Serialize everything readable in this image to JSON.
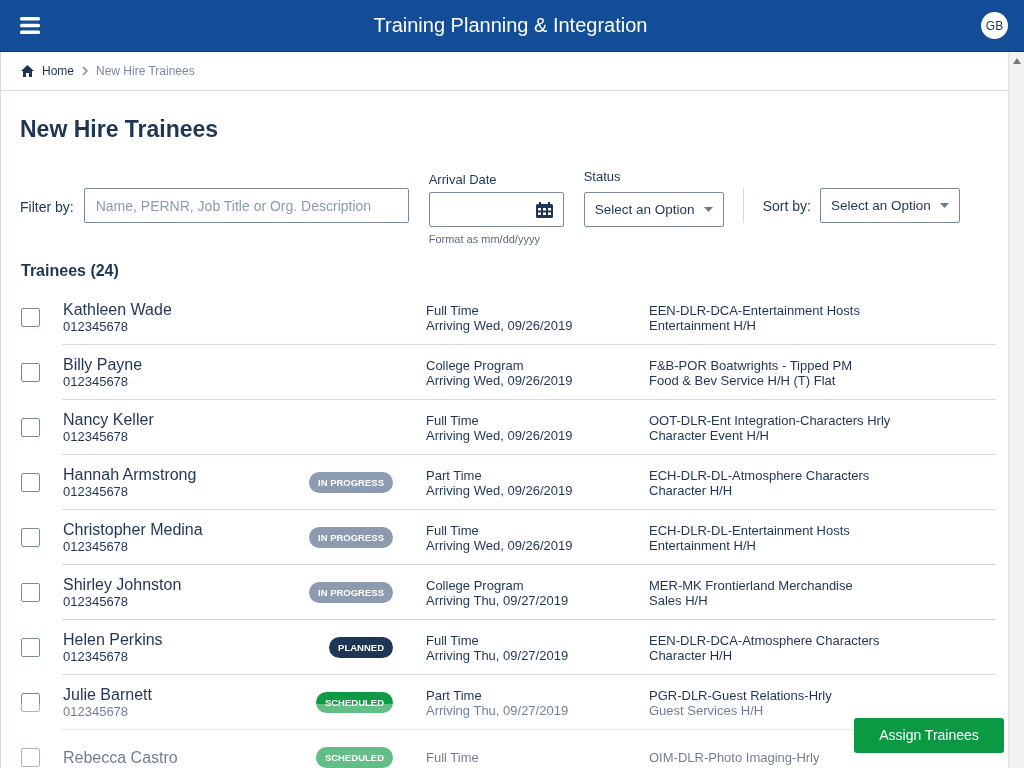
{
  "header": {
    "title": "Training Planning & Integration",
    "avatar": "GB"
  },
  "breadcrumb": [
    {
      "label": "Home",
      "current": false
    },
    {
      "label": "New Hire Trainees",
      "current": true
    }
  ],
  "page_title": "New Hire Trainees",
  "filters": {
    "filter_label": "Filter by:",
    "search_placeholder": "Name, PERNR, Job Title or Org. Description",
    "arrival_label": "Arrival Date",
    "arrival_hint": "Format as mm/dd/yyyy",
    "status_label": "Status",
    "status_value": "Select an Option",
    "sort_label": "Sort by:",
    "sort_value": "Select an Option"
  },
  "list_title": "Trainees (24)",
  "trainees": [
    {
      "name": "Kathleen Wade",
      "id": "012345678",
      "type": "Full Time",
      "arrival": "Arriving Wed, 09/26/2019",
      "org": "EEN-DLR-DCA-Entertainment Hosts",
      "role": "Entertainment H/H",
      "checked": false
    },
    {
      "name": "Billy Payne",
      "id": "012345678",
      "type": "College Program",
      "arrival": "Arriving Wed, 09/26/2019",
      "org": "F&B-POR Boatwrights - Tipped PM",
      "role": "Food & Bev Service H/H (T) Flat",
      "checked": false
    },
    {
      "name": "Nancy Keller",
      "id": "012345678",
      "type": "Full Time",
      "arrival": "Arriving Wed, 09/26/2019",
      "org": "OOT-DLR-Ent Integration-Characters Hrly",
      "role": "Character Event H/H",
      "checked": false
    },
    {
      "name": "Hannah Armstrong",
      "id": "012345678",
      "status": {
        "kind": "in_progress",
        "label": "IN PROGRESS"
      },
      "type": "Part Time",
      "arrival": "Arriving Wed, 09/26/2019",
      "org": "ECH-DLR-DL-Atmosphere Characters",
      "role": "Character H/H",
      "checked": false
    },
    {
      "name": "Christopher Medina",
      "id": "012345678",
      "status": {
        "kind": "in_progress",
        "label": "IN PROGRESS"
      },
      "type": "Full Time",
      "arrival": "Arriving Wed, 09/26/2019",
      "org": "ECH-DLR-DL-Entertainment Hosts",
      "role": "Entertainment H/H",
      "checked": false
    },
    {
      "name": "Shirley Johnston",
      "id": "012345678",
      "status": {
        "kind": "in_progress",
        "label": "IN PROGRESS"
      },
      "type": "College Program",
      "arrival": "Arriving Thu, 09/27/2019",
      "org": "MER-MK Frontierland Merchandise",
      "role": "Sales H/H",
      "checked": false
    },
    {
      "name": "Helen Perkins",
      "id": "012345678",
      "status": {
        "kind": "planned",
        "label": "PLANNED"
      },
      "type": "Full Time",
      "arrival": "Arriving Thu, 09/27/2019",
      "org": "EEN-DLR-DCA-Atmosphere Characters",
      "role": "Character H/H",
      "checked": false
    },
    {
      "name": "Julie Barnett",
      "id": "012345678",
      "status": {
        "kind": "scheduled",
        "label": "SCHEDULED"
      },
      "type": "Part Time",
      "arrival": "Arriving Thu, 09/27/2019",
      "org": "PGR-DLR-Guest Relations-Hrly",
      "role": "Guest Services H/H",
      "checked": false
    },
    {
      "name": "Rebecca Castro",
      "status": {
        "kind": "scheduled",
        "label": "SCHEDULED"
      },
      "type": "Full Time",
      "org": "OIM-DLR-Photo Imaging-Hrly",
      "checked": false
    }
  ],
  "assign_button": "Assign Trainees"
}
